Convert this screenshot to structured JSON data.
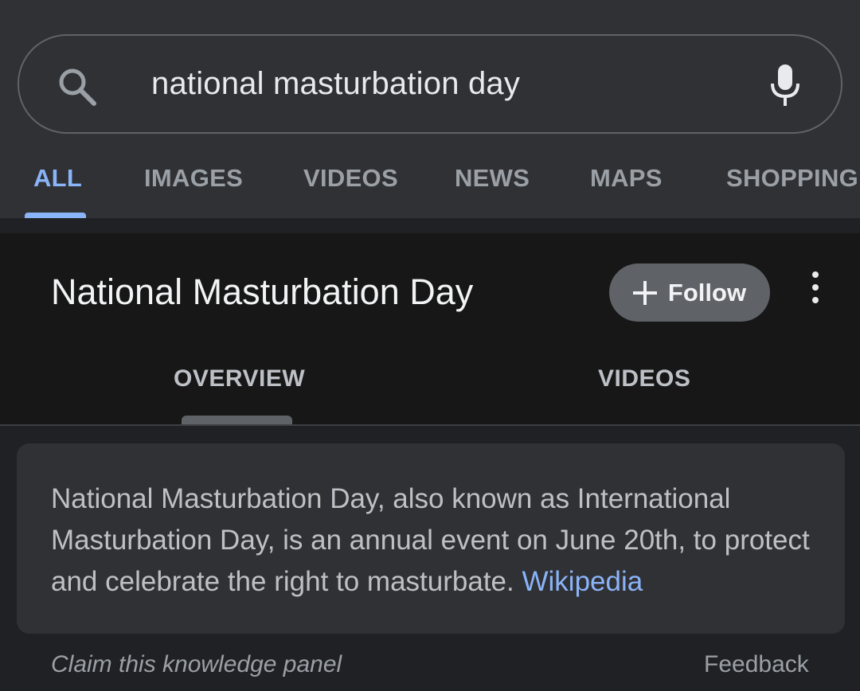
{
  "search": {
    "query": "national masturbation day",
    "search_icon": "search-icon",
    "mic_icon": "mic-icon"
  },
  "tabs": [
    {
      "label": "ALL",
      "active": true
    },
    {
      "label": "IMAGES",
      "active": false
    },
    {
      "label": "VIDEOS",
      "active": false
    },
    {
      "label": "NEWS",
      "active": false
    },
    {
      "label": "MAPS",
      "active": false
    },
    {
      "label": "SHOPPING",
      "active": false
    }
  ],
  "knowledge_panel": {
    "title": "National Masturbation Day",
    "follow_label": "Follow",
    "more_icon": "more-vert-icon",
    "tabs": [
      {
        "label": "OVERVIEW",
        "active": true
      },
      {
        "label": "VIDEOS",
        "active": false
      }
    ],
    "description": "National Masturbation Day, also known as International Masturbation Day, is an annual event on June 20th, to protect and celebrate the right to masturbate.",
    "source_link": "Wikipedia",
    "claim_label": "Claim this knowledge panel",
    "feedback_label": "Feedback"
  },
  "colors": {
    "accent": "#8ab4f8",
    "background": "#202124",
    "surface": "#303134",
    "panel_header": "#171717"
  }
}
